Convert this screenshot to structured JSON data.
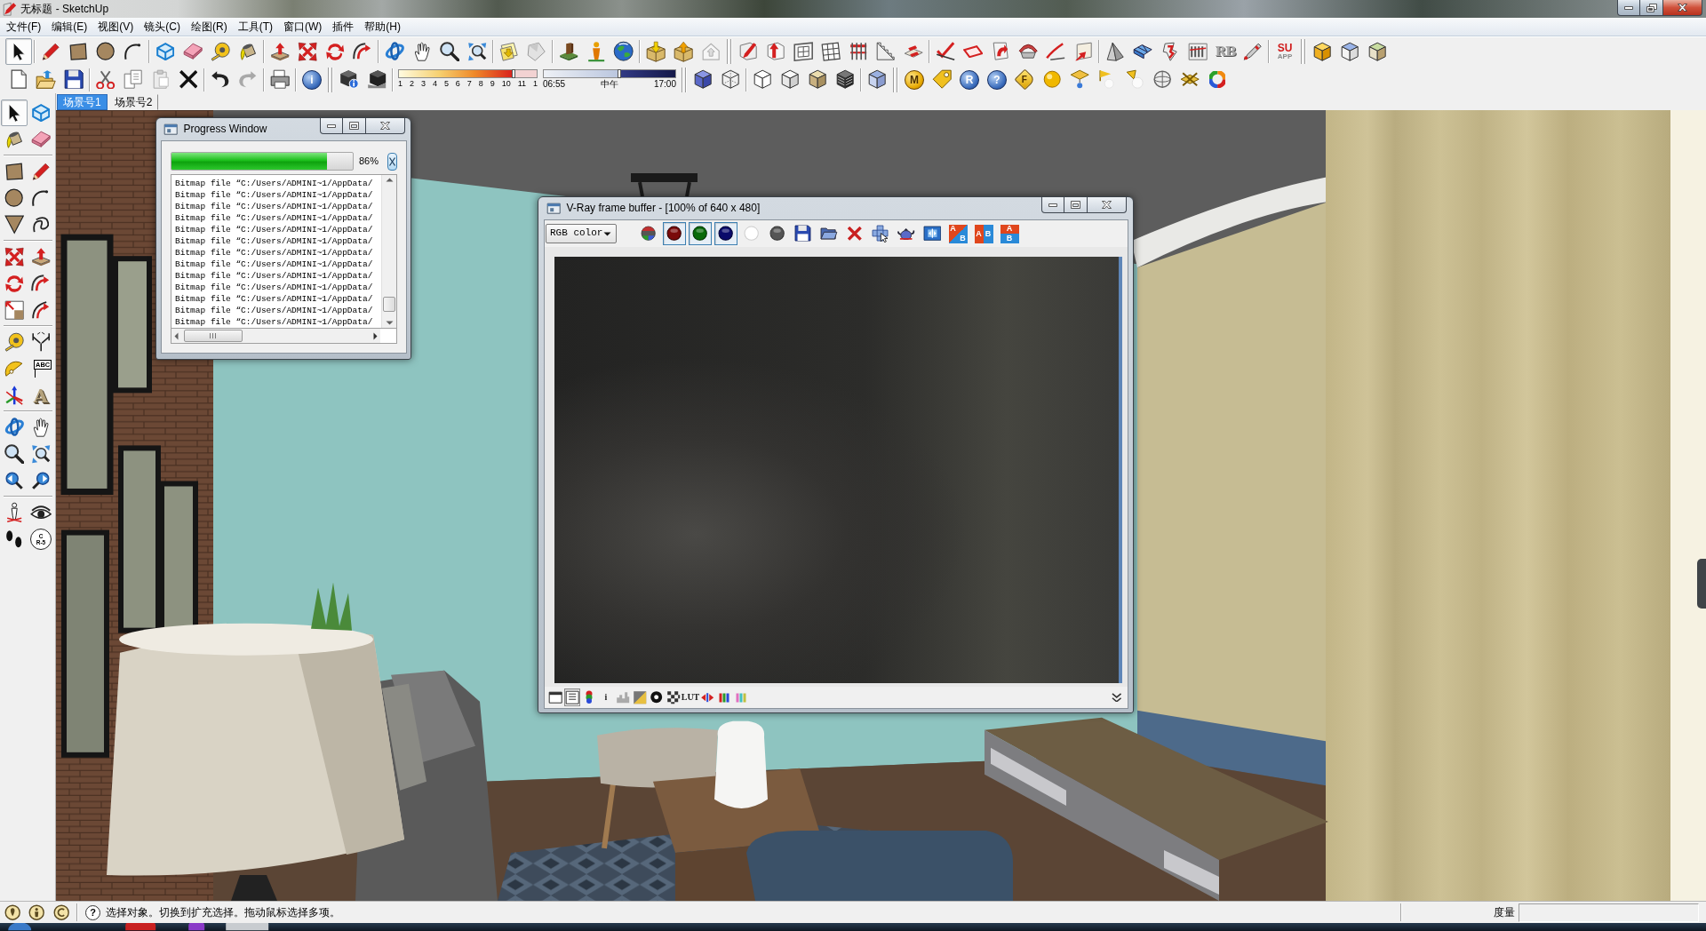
{
  "window": {
    "title": "无标题 - SketchUp"
  },
  "menu": [
    "文件(F)",
    "编辑(E)",
    "视图(V)",
    "镜头(C)",
    "绘图(R)",
    "工具(T)",
    "窗口(W)",
    "插件",
    "帮助(H)"
  ],
  "toolbar_row_1": [
    [
      [
        {
          "kind": "cursor",
          "selected": true
        }
      ],
      [
        {
          "kind": "pencil",
          "selected": false
        },
        {
          "kind": "square",
          "selected": false
        },
        {
          "kind": "circle",
          "selected": false
        },
        {
          "kind": "arc",
          "selected": false
        }
      ],
      [
        {
          "kind": "wirebox",
          "selected": false
        },
        {
          "kind": "eraser",
          "selected": false
        },
        {
          "kind": "tape",
          "selected": false
        },
        {
          "kind": "bucket",
          "selected": false
        }
      ],
      [
        {
          "kind": "pushpull",
          "selected": false
        },
        {
          "kind": "move",
          "selected": false
        },
        {
          "kind": "rotate",
          "selected": false
        },
        {
          "kind": "followme",
          "selected": false
        }
      ],
      [
        {
          "kind": "orbit",
          "selected": false
        },
        {
          "kind": "hand",
          "selected": false
        },
        {
          "kind": "zoom",
          "selected": false
        },
        {
          "kind": "zoomext",
          "selected": false
        }
      ],
      [
        {
          "kind": "pagearrow",
          "selected": false
        },
        {
          "kind": "sheet",
          "selected": false
        }
      ],
      [
        {
          "kind": "terrain",
          "selected": false
        },
        {
          "kind": "figure",
          "selected": false
        },
        {
          "kind": "globe",
          "selected": false
        }
      ],
      [
        {
          "kind": "boxdown",
          "selected": false
        },
        {
          "kind": "boxup",
          "selected": false
        },
        {
          "kind": "house",
          "selected": false
        }
      ]
    ],
    [
      [
        {
          "kind": "pencilbox",
          "selected": false
        },
        {
          "kind": "arrowbox",
          "selected": false
        },
        {
          "kind": "frame",
          "selected": false
        },
        {
          "kind": "grid",
          "selected": false
        },
        {
          "kind": "fence",
          "selected": false
        },
        {
          "kind": "stairs",
          "selected": false
        },
        {
          "kind": "plate",
          "selected": false
        }
      ],
      [
        {
          "kind": "checkline",
          "selected": false
        },
        {
          "kind": "faceoutline",
          "selected": false
        },
        {
          "kind": "turnarrow",
          "selected": false
        },
        {
          "kind": "mesharc",
          "selected": false
        },
        {
          "kind": "curve",
          "selected": false
        },
        {
          "kind": "paperarrow",
          "selected": false
        }
      ],
      [
        {
          "kind": "pyramid",
          "selected": false
        },
        {
          "kind": "panels",
          "selected": false
        },
        {
          "kind": "bentline",
          "selected": false
        },
        {
          "kind": "column",
          "selected": false
        },
        {
          "kind": "embossed",
          "text": "RB",
          "selected": false
        },
        {
          "kind": "pen",
          "selected": false
        }
      ],
      [
        {
          "kind": "logo",
          "lines": [
            "SU",
            "APP"
          ],
          "selected": false
        }
      ]
    ],
    [
      [
        {
          "kind": "solida",
          "selected": false
        },
        {
          "kind": "solidb",
          "selected": false
        },
        {
          "kind": "solidc",
          "selected": false
        }
      ]
    ]
  ],
  "toolbar_row_2": [
    [
      [
        {
          "kind": "document",
          "selected": false
        },
        {
          "kind": "openfolder",
          "selected": false
        },
        {
          "kind": "floppy",
          "selected": false
        }
      ],
      [
        {
          "kind": "scissors",
          "selected": false
        },
        {
          "kind": "copy",
          "selected": false
        },
        {
          "kind": "paste",
          "selected": false
        },
        {
          "kind": "deletex",
          "selected": false
        }
      ],
      [
        {
          "kind": "undo",
          "selected": false
        },
        {
          "kind": "redo",
          "selected": false
        }
      ],
      [
        {
          "kind": "printer",
          "selected": false
        }
      ],
      [
        {
          "kind": "bluecoin",
          "text": "i",
          "selected": false
        }
      ]
    ],
    [
      [
        {
          "kind": "boxinfo",
          "selected": false
        },
        {
          "kind": "shadowbox",
          "selected": false
        }
      ],
      [
        {
          "kind": "months",
          "level": 0.84,
          "labels": [
            "1",
            "2",
            "3",
            "4",
            "5",
            "6",
            "7",
            "8",
            "9",
            "10",
            "11",
            "1"
          ]
        },
        {
          "kind": "daytime",
          "level": 0.58,
          "labels": [
            "06:55",
            "中午",
            "17:00"
          ]
        }
      ]
    ],
    [
      [
        {
          "kind": "transcube",
          "selected": false
        },
        {
          "kind": "wirecube",
          "selected": false
        }
      ],
      [
        {
          "kind": "hiddencube",
          "selected": false
        },
        {
          "kind": "plaincube",
          "selected": false
        },
        {
          "kind": "shadedcube",
          "selected": false
        },
        {
          "kind": "texturedcube",
          "selected": false
        }
      ],
      [
        {
          "kind": "monocube",
          "selected": false
        }
      ]
    ],
    [
      [
        {
          "kind": "goldcoin",
          "text": "M",
          "selected": false
        },
        {
          "kind": "tag",
          "selected": false
        },
        {
          "kind": "bluecoin",
          "text": "R",
          "selected": false
        },
        {
          "kind": "bluecoin",
          "text": "?",
          "selected": false
        },
        {
          "kind": "goldtag",
          "text": "F",
          "selected": false
        },
        {
          "kind": "sphere",
          "selected": false
        },
        {
          "kind": "lightplane",
          "selected": false
        },
        {
          "kind": "flag",
          "selected": false
        },
        {
          "kind": "spot",
          "selected": false
        },
        {
          "kind": "sphereoutline",
          "selected": false
        },
        {
          "kind": "crossplane",
          "selected": false
        },
        {
          "kind": "colorring",
          "selected": false
        }
      ]
    ]
  ],
  "scene_tabs": [
    {
      "label": "场景号1",
      "selected": true
    },
    {
      "label": "场景号2",
      "selected": false
    }
  ],
  "left_toolbar": [
    [
      {
        "kind": "cursor",
        "selected": true
      },
      {
        "kind": "wirebox",
        "selected": false
      },
      {
        "kind": "bucket",
        "selected": false
      },
      {
        "kind": "eraser",
        "selected": false
      }
    ],
    [
      {
        "kind": "square",
        "selected": false
      },
      {
        "kind": "pencil",
        "selected": false
      },
      {
        "kind": "circle",
        "selected": false
      },
      {
        "kind": "arc",
        "selected": false
      },
      {
        "kind": "triangle",
        "selected": false
      },
      {
        "kind": "scribble",
        "selected": false
      }
    ],
    [
      {
        "kind": "move",
        "selected": false
      },
      {
        "kind": "pushpull",
        "selected": false
      },
      {
        "kind": "rotate",
        "selected": false
      },
      {
        "kind": "followme",
        "selected": false
      },
      {
        "kind": "scale",
        "selected": false
      },
      {
        "kind": "offset",
        "selected": false
      }
    ],
    [
      {
        "kind": "tape",
        "selected": false
      },
      {
        "kind": "dimension",
        "selected": false
      },
      {
        "kind": "protractor",
        "selected": false
      },
      {
        "kind": "callout",
        "text": "ABC",
        "selected": false
      },
      {
        "kind": "axes",
        "selected": false
      },
      {
        "kind": "bigletter",
        "text": "A",
        "selected": false
      }
    ],
    [
      {
        "kind": "orbit",
        "selected": false
      },
      {
        "kind": "hand",
        "selected": false
      },
      {
        "kind": "zoom",
        "selected": false
      },
      {
        "kind": "zoomext",
        "selected": false
      },
      {
        "kind": "prevview",
        "selected": false
      },
      {
        "kind": "nextview",
        "selected": false
      }
    ],
    [
      {
        "kind": "person",
        "selected": false
      },
      {
        "kind": "eye",
        "selected": false
      },
      {
        "kind": "footprints",
        "selected": false
      },
      {
        "kind": "section",
        "lines": [
          "C",
          "R-5"
        ],
        "selected": false
      }
    ]
  ],
  "progress_window": {
    "title": "Progress Window",
    "progress": {
      "level": 0.86,
      "reading": "86%"
    },
    "log": [
      "Bitmap file “C:/Users/ADMINI~1/AppData/",
      "Bitmap file “C:/Users/ADMINI~1/AppData/",
      "Bitmap file “C:/Users/ADMINI~1/AppData/",
      "Bitmap file “C:/Users/ADMINI~1/AppData/",
      "Bitmap file “C:/Users/ADMINI~1/AppData/",
      "Bitmap file “C:/Users/ADMINI~1/AppData/",
      "Bitmap file “C:/Users/ADMINI~1/AppData/",
      "Bitmap file “C:/Users/ADMINI~1/AppData/",
      "Bitmap file “C:/Users/ADMINI~1/AppData/",
      "Bitmap file “C:/Users/ADMINI~1/AppData/",
      "Bitmap file “C:/Users/ADMINI~1/AppData/",
      "Bitmap file “C:/Users/ADMINI~1/AppData/",
      "Bitmap file “C:/Users/ADMINI~1/AppData/"
    ]
  },
  "vray_window": {
    "title": "V-Ray frame buffer - [100% of 640 x 480]",
    "channel_select": "RGB color",
    "tools": [
      {
        "kind": "rgbdot",
        "selected": false
      },
      {
        "kind": "reddot",
        "selected": true
      },
      {
        "kind": "greendot",
        "selected": true
      },
      {
        "kind": "bluedot",
        "selected": true
      },
      {
        "kind": "whitedot",
        "selected": false
      },
      {
        "kind": "graydot",
        "selected": false
      },
      {
        "kind": "floppy",
        "selected": false
      },
      {
        "kind": "folder",
        "selected": false
      },
      {
        "kind": "redx",
        "selected": false
      },
      {
        "kind": "region",
        "selected": false
      },
      {
        "kind": "teapot",
        "selected": false
      },
      {
        "kind": "split",
        "selected": false
      },
      {
        "kind": "abdiag",
        "lines": [
          "A",
          "B"
        ],
        "selected": false
      },
      {
        "kind": "abside",
        "lines": [
          "A",
          "B"
        ],
        "selected": false
      },
      {
        "kind": "abstack",
        "lines": [
          "A",
          "B"
        ],
        "selected": false
      }
    ],
    "bottom_tools": [
      {
        "kind": "winbox",
        "selected": false
      },
      {
        "kind": "panel",
        "selected": true
      },
      {
        "kind": "layers",
        "selected": false
      },
      {
        "kind": "letter",
        "text": "i",
        "selected": false
      },
      {
        "kind": "histogram",
        "selected": false
      },
      {
        "kind": "gradient",
        "selected": false
      },
      {
        "kind": "dotb",
        "selected": false
      },
      {
        "kind": "checker",
        "selected": false
      },
      {
        "kind": "letter",
        "text": "LUT",
        "selected": false
      },
      {
        "kind": "pinch",
        "selected": false
      },
      {
        "kind": "bars",
        "selected": false
      },
      {
        "kind": "bars2",
        "selected": false
      }
    ]
  },
  "status_bar": {
    "help_mark": "?",
    "message": "选择对象。切换到扩充选择。拖动鼠标选择多项。",
    "measurement_label": "度量"
  }
}
